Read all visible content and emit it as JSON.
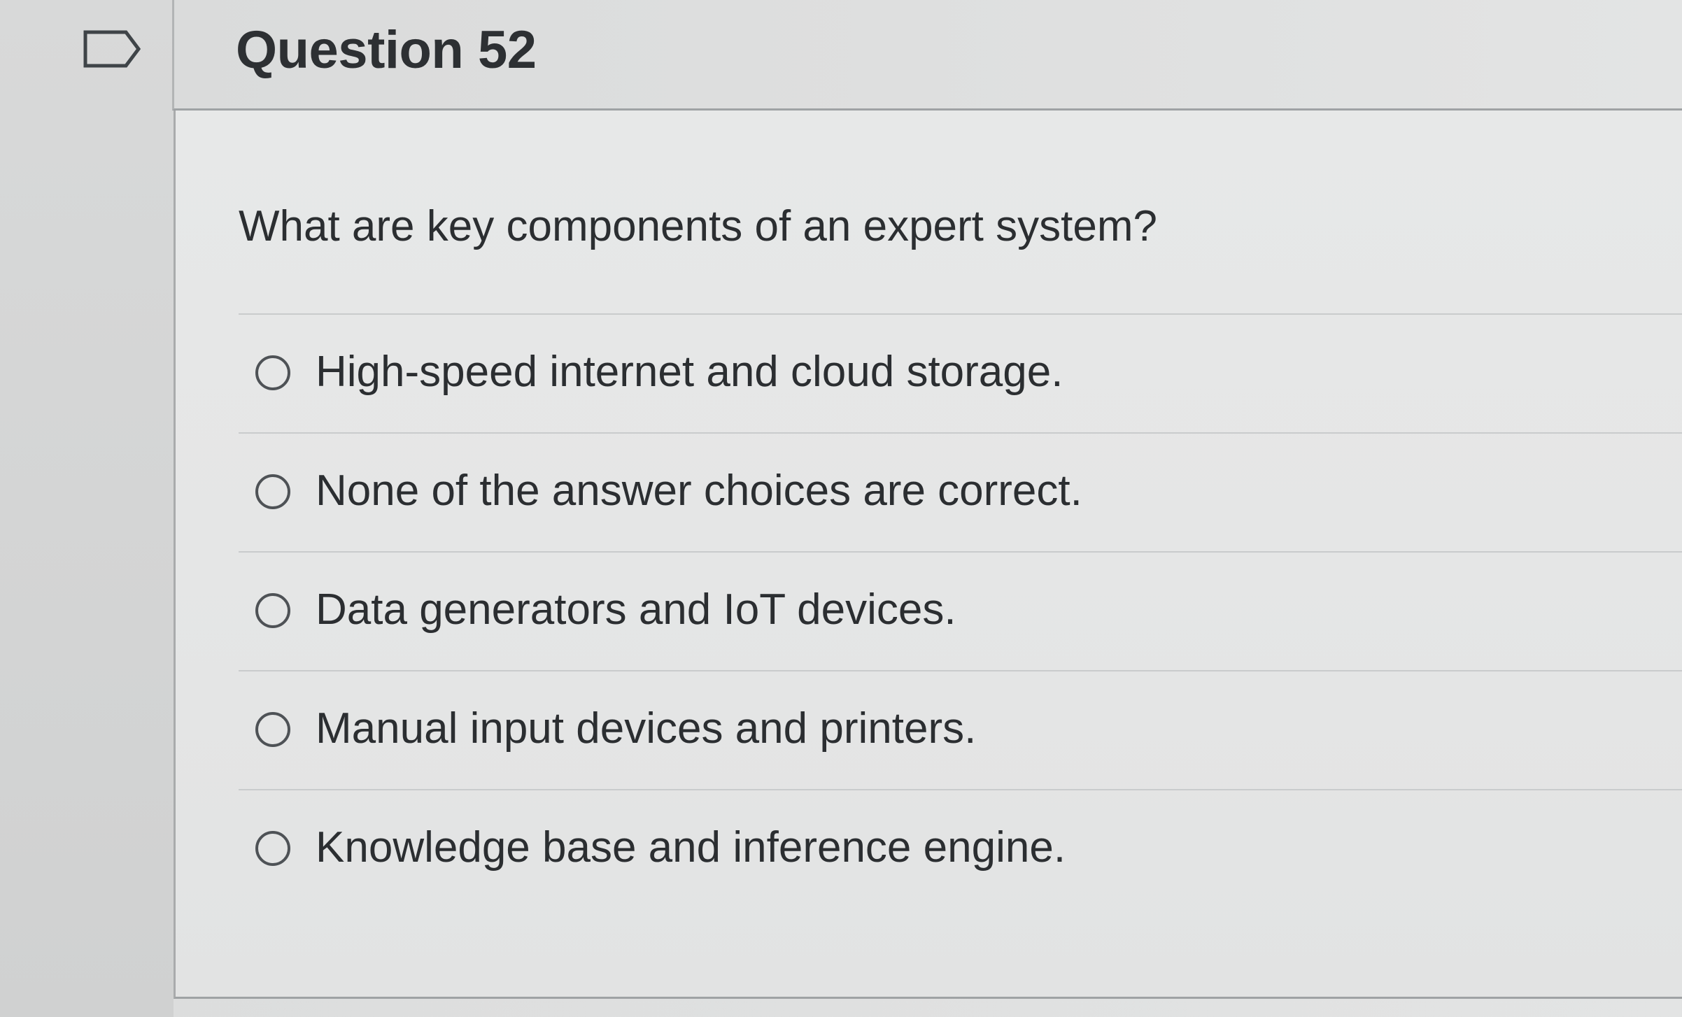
{
  "question": {
    "title": "Question 52",
    "prompt": "What are key components of an expert system?",
    "answers": [
      {
        "label": "High-speed internet and cloud storage."
      },
      {
        "label": "None of the answer choices are correct."
      },
      {
        "label": "Data generators and IoT devices."
      },
      {
        "label": "Manual input devices and printers."
      },
      {
        "label": "Knowledge base and inference engine."
      }
    ]
  },
  "icons": {
    "flag": "flag-outline-icon"
  },
  "colors": {
    "text": "#2b2e31",
    "divider": "#c9cbcc",
    "radio_border": "#4e5256",
    "background": "#e3e4e4"
  }
}
